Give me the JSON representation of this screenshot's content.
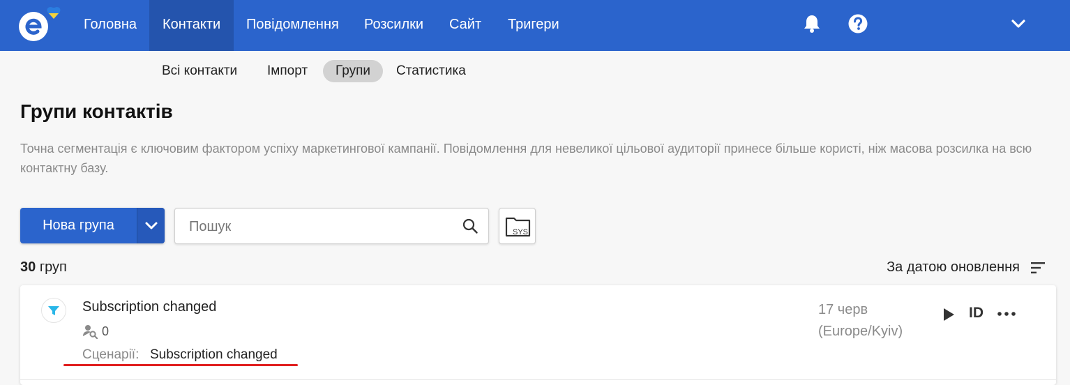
{
  "nav": {
    "items": [
      {
        "label": "Головна"
      },
      {
        "label": "Контакти"
      },
      {
        "label": "Повідомлення"
      },
      {
        "label": "Розсилки"
      },
      {
        "label": "Сайт"
      },
      {
        "label": "Тригери"
      }
    ],
    "active": "Контакти"
  },
  "subnav": {
    "items": [
      {
        "label": "Всі контакти"
      },
      {
        "label": "Імпорт"
      },
      {
        "label": "Групи"
      },
      {
        "label": "Статистика"
      }
    ],
    "active": "Групи"
  },
  "page": {
    "title": "Групи контактів",
    "description": "Точна сегментація є ключовим фактором успіху маркетингової кампанії. Повідомлення для невеликої цільової аудиторії принесе більше користі, ніж масова розсилка на всю контактну базу."
  },
  "toolbar": {
    "new_group_label": "Нова група",
    "search_placeholder": "Пошук",
    "search_value": "",
    "sys_label": "SYS"
  },
  "list": {
    "count": "30",
    "count_unit": "груп",
    "sort_label": "За датою оновлення"
  },
  "groups": [
    {
      "title": "Subscription changed",
      "members": "0",
      "scenario_label": "Сценарії:",
      "scenario_value": "Subscription changed",
      "date": "17 черв",
      "timezone": "(Europe/Kyiv)",
      "id_label": "ID"
    }
  ],
  "colors": {
    "brand": "#2b64cc",
    "nav_active": "#2454ad",
    "annotation": "#e01e1e",
    "funnel": "#29b6e8"
  }
}
